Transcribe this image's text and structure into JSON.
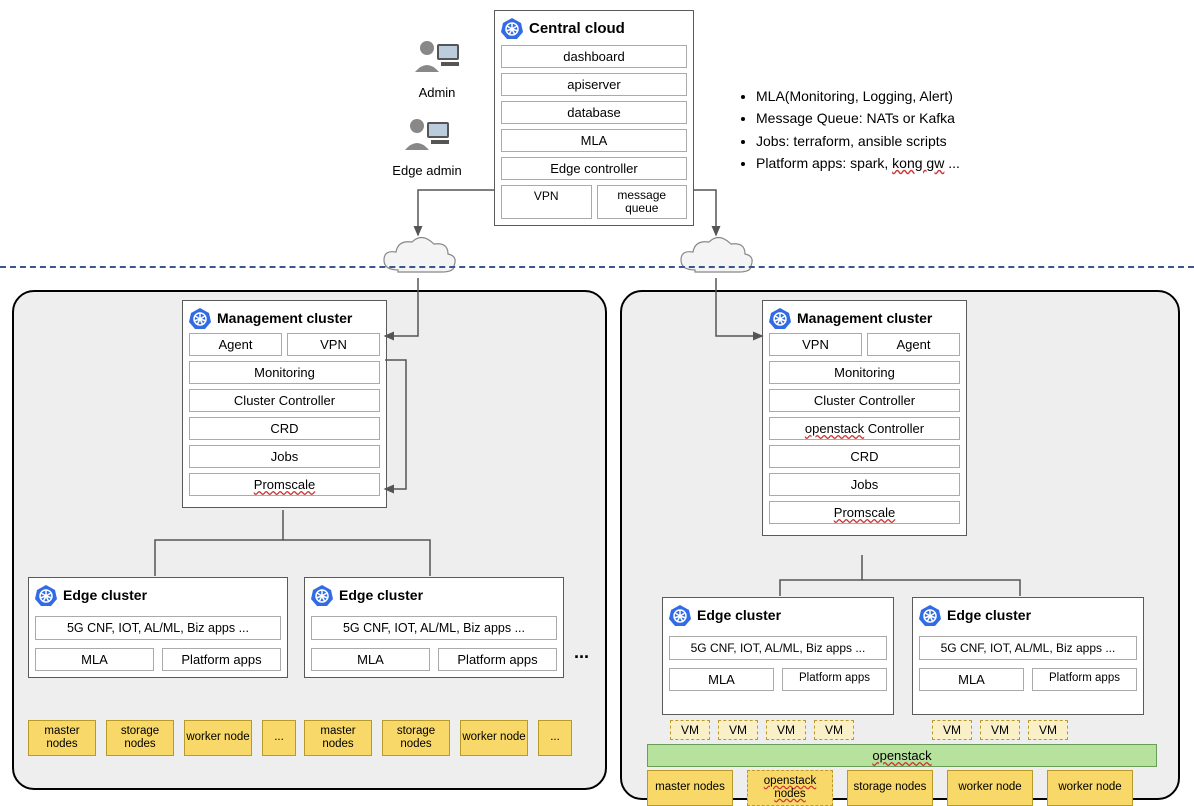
{
  "actors": {
    "admin": "Admin",
    "edge_admin": "Edge admin"
  },
  "central": {
    "title": "Central cloud",
    "items": [
      "dashboard",
      "apiserver",
      "database",
      "MLA",
      "Edge controller"
    ],
    "vpn": "VPN",
    "mq": "message queue"
  },
  "bullets": [
    {
      "text": "MLA(Monitoring, Logging, Alert)"
    },
    {
      "text": "Message Queue: NATs or Kafka"
    },
    {
      "text": "Jobs: terraform, ansible scripts"
    },
    {
      "prefix": "Platform apps: spark, ",
      "squig": "kong gw",
      "suffix": " ..."
    }
  ],
  "mgmt_left": {
    "title": "Management cluster",
    "agent": "Agent",
    "vpn": "VPN",
    "items": [
      "Monitoring",
      "Cluster Controller",
      "CRD",
      "Jobs"
    ],
    "last": "Promscale"
  },
  "mgmt_right": {
    "title": "Management cluster",
    "vpn": "VPN",
    "agent": "Agent",
    "items": [
      "Monitoring",
      "Cluster Controller"
    ],
    "openstack_ctrl_prefix": "openstack",
    "openstack_ctrl_suffix": " Controller",
    "tail": [
      "CRD",
      "Jobs"
    ],
    "last": "Promscale"
  },
  "edge": {
    "title": "Edge cluster",
    "apps": "5G CNF, IOT, AL/ML, Biz apps ...",
    "mla": "MLA",
    "platform": "Platform apps"
  },
  "nodes": {
    "master": "master nodes",
    "storage": "storage nodes",
    "worker": "worker node",
    "openstack_nodes": "openstack nodes",
    "dots": "..."
  },
  "vm": "VM",
  "openstack": "openstack"
}
